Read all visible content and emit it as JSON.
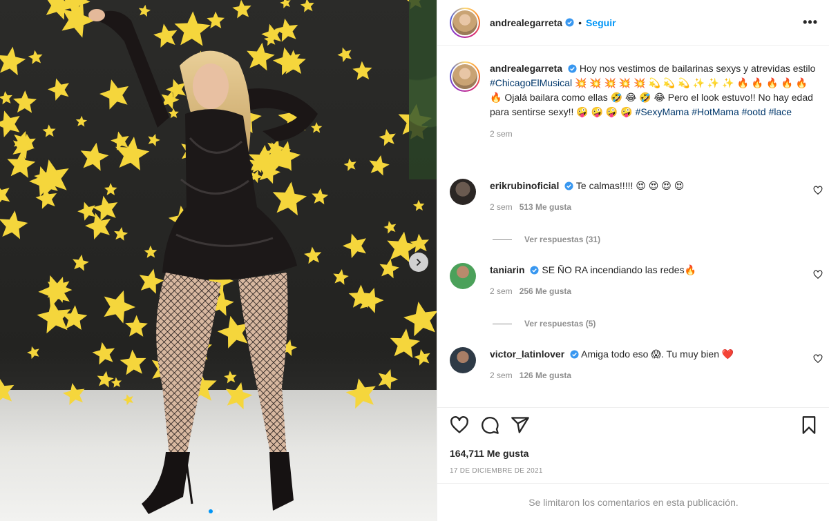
{
  "post": {
    "author": "andrealegarreta",
    "follow_label": "Seguir",
    "separator": "•",
    "more_label": "•••"
  },
  "caption": {
    "username": "andrealegarreta",
    "text_1": "Hoy nos vestimos de bailarinas sexys y atrevidas estilo ",
    "hashtag_1": "#ChicagoElMusical",
    "text_2": " 💥 💥 💥 💥 💥 💫 💫 💫 ✨ ✨ ✨ 🔥 🔥 🔥 🔥 🔥 🔥 Ojalá bailara como ellas 🤣 😂 🤣 😂 Pero el look estuvo!! No hay edad para sentirse sexy!! 🤪 🤪 🤪 🤪 ",
    "hashtag_2": "#SexyMama",
    "hashtag_3": "#HotMama",
    "hashtag_4": "#ootd",
    "hashtag_5": "#lace",
    "time": "2 sem"
  },
  "comments": [
    {
      "username": "erikrubinoficial",
      "text": "Te calmas!!!!! 😍 😍 😍 😍",
      "time": "2 sem",
      "likes": "513 Me gusta",
      "replies": "Ver respuestas (31)"
    },
    {
      "username": "taniarin",
      "text": "SE ÑO RA incendiando las redes🔥",
      "time": "2 sem",
      "likes": "256 Me gusta",
      "replies": "Ver respuestas (5)"
    },
    {
      "username": "victor_latinlover",
      "text": "Amiga todo eso 😱. Tu muy bien ❤️",
      "time": "2 sem",
      "likes": "126 Me gusta"
    }
  ],
  "actions": {
    "likes": "164,711 Me gusta",
    "date": "17 DE DICIEMBRE DE 2021",
    "limited": "Se limitaron los comentarios en esta publicación."
  },
  "colors": {
    "link": "#00376b",
    "follow": "#0095f6",
    "muted": "#8e8e8e",
    "star": "#f5d63c"
  },
  "icons": [
    "verified-icon",
    "more-icon",
    "heart-icon",
    "comment-icon",
    "share-icon",
    "save-icon",
    "chevron-right-icon"
  ]
}
